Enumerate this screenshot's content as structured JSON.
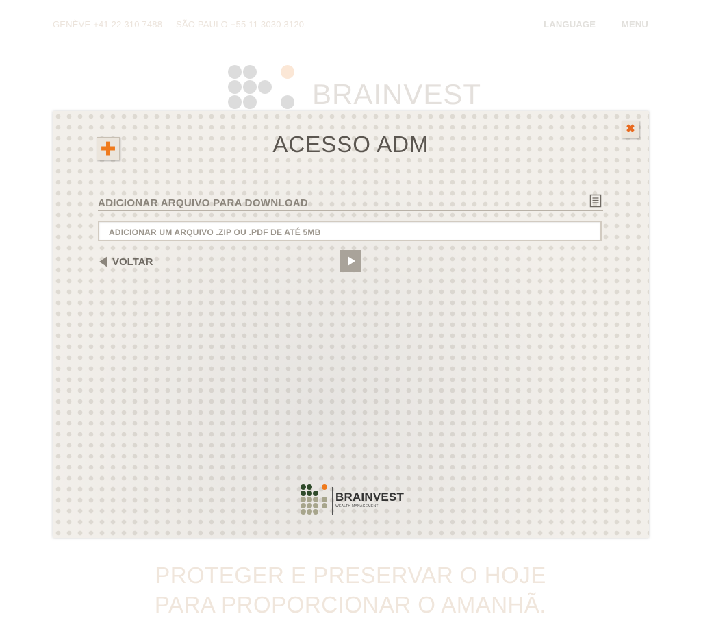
{
  "topbar": {
    "contact_geneve": "GENÈVE +41 22 310 7488",
    "contact_saopaulo": "SÃO PAULO +55 11 3030 3120",
    "language_label": "LANGUAGE",
    "menu_label": "MENU"
  },
  "brand": {
    "name": "BRAINVEST",
    "subtitle": "WEALTH MANAGEMENT"
  },
  "tagline": {
    "line1": "PROTEGER E PRESERVAR O HOJE",
    "line2": "PARA PROPORCIONAR O AMANHÃ."
  },
  "modal": {
    "title": "ACESSO ADM",
    "close_symbol": "✖",
    "add_symbol": "✚",
    "section_label": "ADICIONAR ARQUIVO PARA DOWNLOAD",
    "file_placeholder": "ADICIONAR UM ARQUIVO .ZIP OU .PDF DE ATÉ 5MB",
    "back_label": "VOLTAR"
  },
  "icons": [
    "close-icon",
    "add-icon",
    "document-icon",
    "back-arrow-icon",
    "play-icon"
  ],
  "colors": {
    "accent_orange": "#ef7a1c",
    "text_dark": "#5b5650",
    "text_muted": "#8b857c",
    "logo_green": "#2f4a2a",
    "logo_olive": "#a7a58c"
  }
}
